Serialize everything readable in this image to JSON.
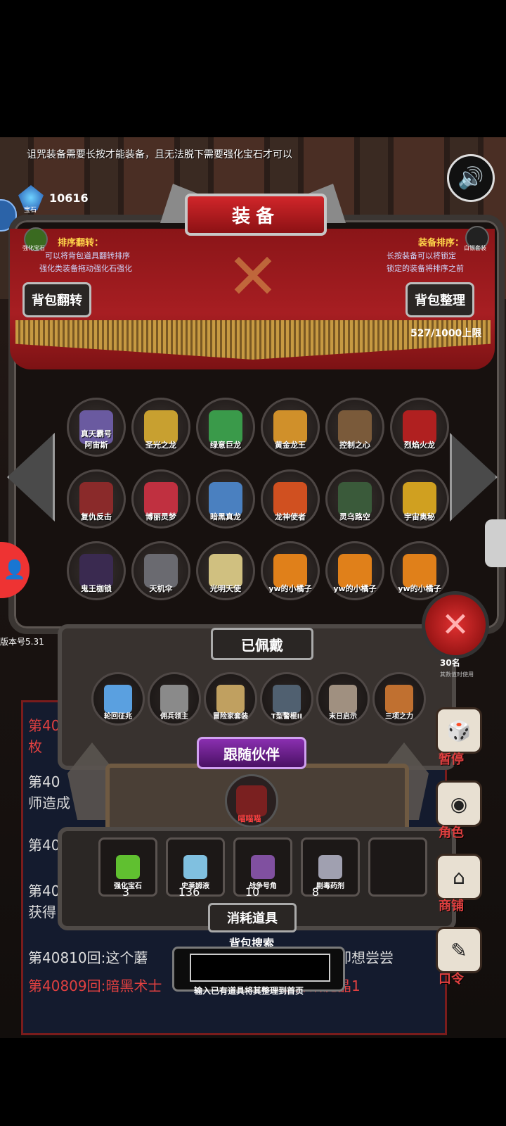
{
  "tip": "诅咒装备需要长按才能装备，且无法脱下需要强化宝石才可以",
  "gem": {
    "count": "10616",
    "label": "宝石"
  },
  "title": "装备",
  "info_left": {
    "heading": "排序翻转：",
    "line1": "可以将背包道具翻转排序",
    "line2": "强化类装备拖动强化石强化"
  },
  "info_right": {
    "heading": "装备排序：",
    "line1": "长按装备可以将锁定",
    "line2": "锁定的装备将排序之前"
  },
  "corner_left_label": "强化宝石",
  "corner_right_label": "白银套装",
  "btn_flip": "背包翻转",
  "btn_sort": "背包整理",
  "capacity": "527/1000上限",
  "items": [
    {
      "name": "真天霸号\n阿宙斯",
      "color": "#6a5aa0"
    },
    {
      "name": "圣光之龙",
      "color": "#c8a030"
    },
    {
      "name": "绿意巨龙",
      "color": "#3a9a4a"
    },
    {
      "name": "黄金龙王",
      "color": "#d0902a"
    },
    {
      "name": "控制之心",
      "color": "#7a5a3a"
    },
    {
      "name": "烈焰火龙",
      "color": "#b02020"
    },
    {
      "name": "复仇反击",
      "color": "#8a2a2a"
    },
    {
      "name": "博丽灵梦",
      "color": "#c03040"
    },
    {
      "name": "暗黑真龙",
      "color": "#4a80c0"
    },
    {
      "name": "龙神使者",
      "color": "#d05020"
    },
    {
      "name": "灵乌路空",
      "color": "#3a5a3a"
    },
    {
      "name": "宇宙奥秘",
      "color": "#d0a020"
    },
    {
      "name": "鬼王枷锁",
      "color": "#3a2a50"
    },
    {
      "name": "天机伞",
      "color": "#6a6a70"
    },
    {
      "name": "光明天使",
      "color": "#d0c080"
    },
    {
      "name": "yw的小橘子",
      "color": "#e0801a"
    },
    {
      "name": "yw的小橘子",
      "color": "#e0801a"
    },
    {
      "name": "yw的小橘子",
      "color": "#e0801a"
    }
  ],
  "version": "版本号5.31",
  "equipped_title": "已佩戴",
  "equipped": [
    {
      "name": "轮回征兆",
      "color": "#5aa0e0"
    },
    {
      "name": "佣兵领主",
      "color": "#8a8a8a"
    },
    {
      "name": "冒险家套装",
      "color": "#c0a060"
    },
    {
      "name": "T型警棍II",
      "color": "#506070"
    },
    {
      "name": "末日启示",
      "color": "#a09080"
    },
    {
      "name": "三项之力",
      "color": "#c07030"
    }
  ],
  "companion_title": "跟随伙伴",
  "companion_name": "喵喵喵",
  "consumables_title": "消耗道具",
  "consumables": [
    {
      "name": "强化宝石",
      "count": "3",
      "color": "#60c030"
    },
    {
      "name": "史莱姆液",
      "count": "136",
      "color": "#80c0e0"
    },
    {
      "name": "战争号角",
      "count": "10",
      "color": "#8050a0"
    },
    {
      "name": "剧毒药剂",
      "count": "8",
      "color": "#a0a0b0"
    },
    {
      "name": "",
      "count": "",
      "color": "#1c1817"
    }
  ],
  "search_label": "背包搜索",
  "search_value": "",
  "search_hint": "输入已有道具将其整理到首页",
  "rank": "30名",
  "rank_sub": "其数值时使用",
  "side_buttons": [
    {
      "label": "暂停",
      "icon": "dice-icon"
    },
    {
      "label": "角色",
      "icon": "character-icon"
    },
    {
      "label": "商铺",
      "icon": "shop-icon"
    },
    {
      "label": "口令",
      "icon": "code-icon"
    }
  ],
  "log": [
    {
      "text": "第40",
      "red": true
    },
    {
      "text": "枚",
      "red": true
    },
    {
      "text": "第40",
      "red": false
    },
    {
      "text": "师造成",
      "red": false
    },
    {
      "text": "第40",
      "red": false
    },
    {
      "text": "第40",
      "red": false
    },
    {
      "text": "获得",
      "red": false
    },
    {
      "text": "第40810回:这个蘑",
      "red": false
    },
    {
      "text": "却想尝尝",
      "red": false
    },
    {
      "text": "第40809回:暗黑术士",
      "red": true
    },
    {
      "text": "枚掉落魔晶1",
      "red": true
    }
  ]
}
